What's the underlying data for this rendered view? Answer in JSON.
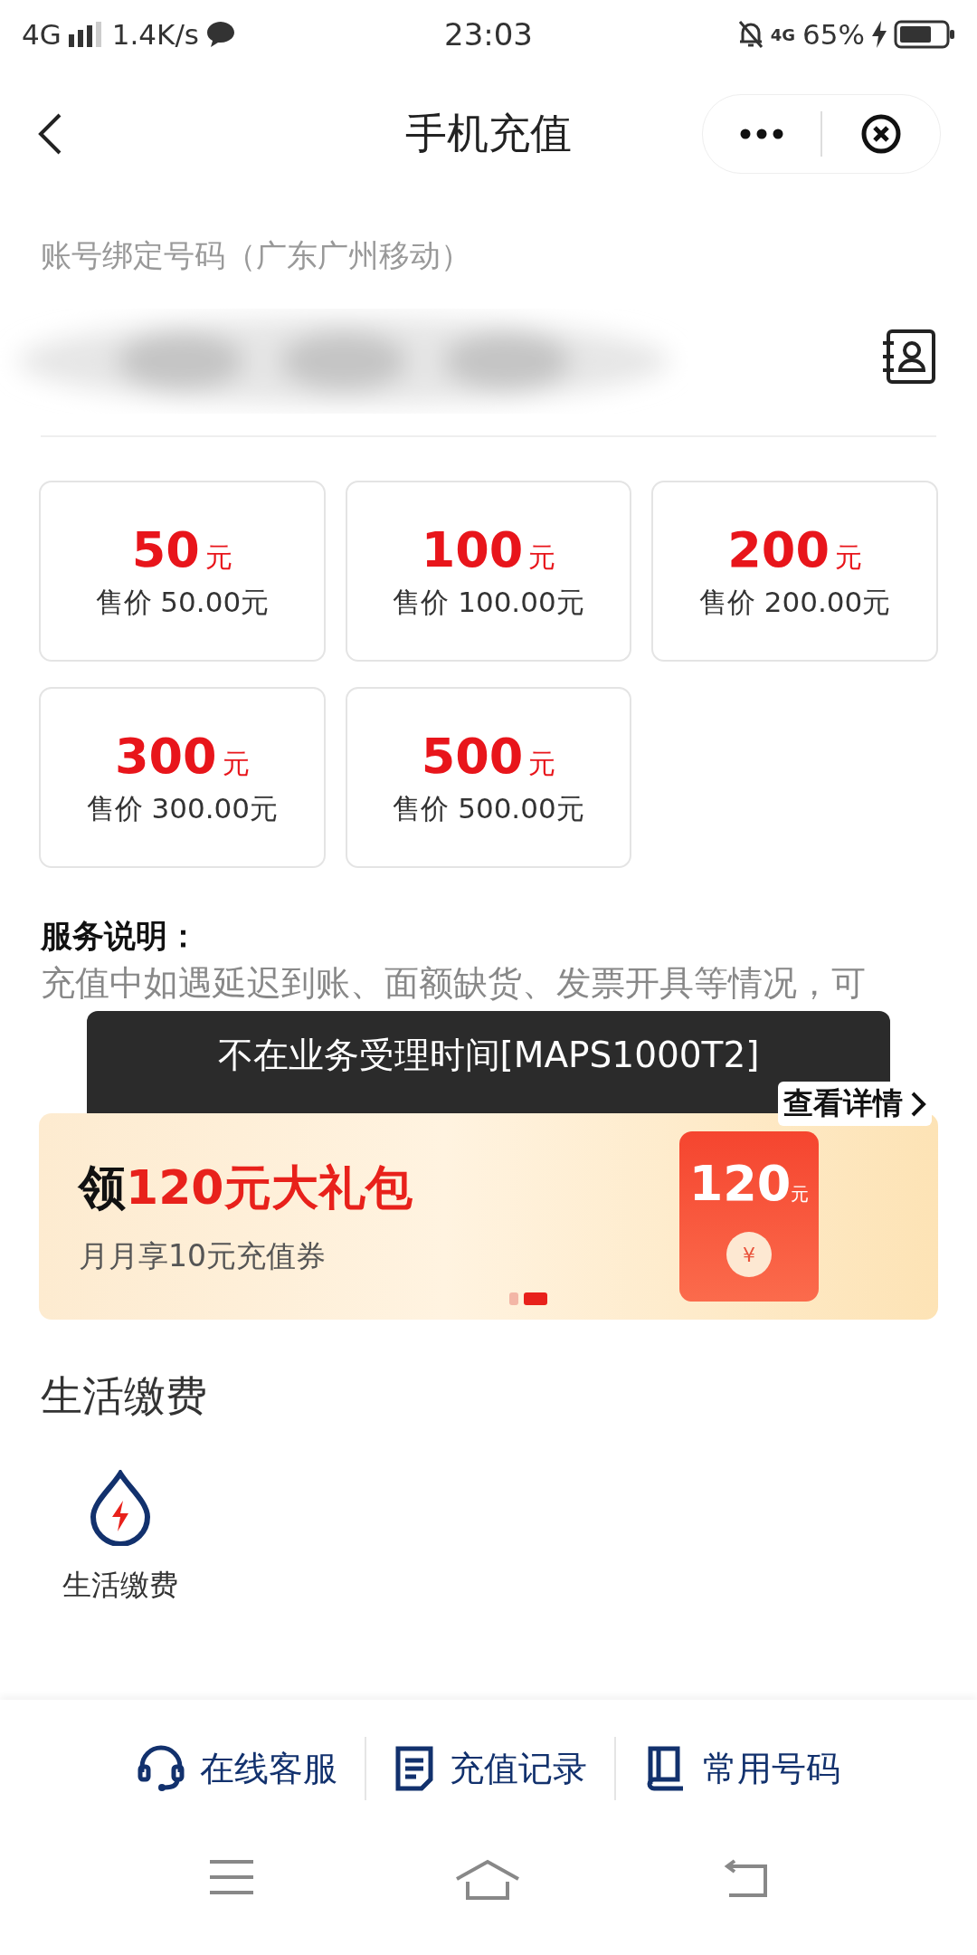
{
  "status_bar": {
    "network": "4G",
    "speed": "1.4K/s",
    "time": "23:03",
    "network_2": "4G",
    "battery": "65%"
  },
  "header": {
    "title": "手机充值"
  },
  "account": {
    "label": "账号绑定号码（广东广州移动）"
  },
  "amounts": [
    {
      "amount": "50",
      "unit": "元",
      "price": "售价 50.00元"
    },
    {
      "amount": "100",
      "unit": "元",
      "price": "售价 100.00元"
    },
    {
      "amount": "200",
      "unit": "元",
      "price": "售价 200.00元"
    },
    {
      "amount": "300",
      "unit": "元",
      "price": "售价 300.00元"
    },
    {
      "amount": "500",
      "unit": "元",
      "price": "售价 500.00元"
    }
  ],
  "service": {
    "title": "服务说明：",
    "text": "充值中如遇延迟到账、面额缺货、发票开具等情况，可",
    "link": "查看详情"
  },
  "toast": "不在业务受理时间[MAPS1000T2]",
  "banner": {
    "title_lead": "领",
    "title_offer": "120元大礼包",
    "subtitle": "月月享10元充值券",
    "badge_amount": "120",
    "badge_unit": "元",
    "coin": "¥",
    "pager": [
      {
        "selected": false
      },
      {
        "selected": true
      }
    ]
  },
  "life_section": {
    "title": "生活缴费",
    "items": [
      {
        "label": "生活缴费"
      }
    ]
  },
  "bottom_bar": [
    {
      "label": "在线客服",
      "kind": "headset"
    },
    {
      "label": "充值记录",
      "kind": "document"
    },
    {
      "label": "常用号码",
      "kind": "book"
    }
  ]
}
